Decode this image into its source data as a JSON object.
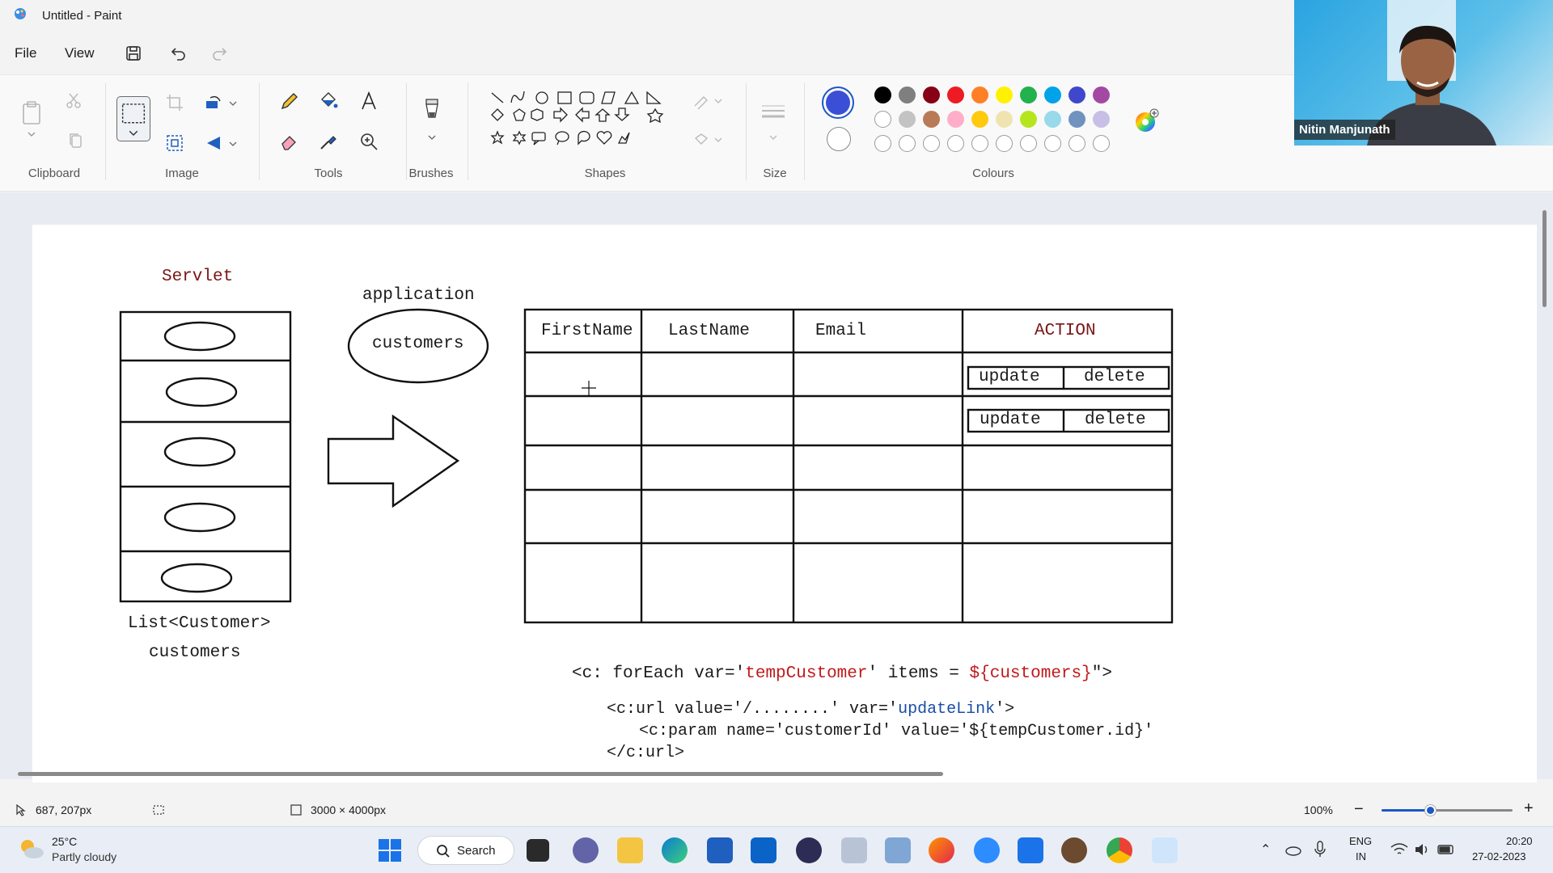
{
  "window": {
    "title": "Untitled - Paint"
  },
  "menu": {
    "file": "File",
    "view": "View"
  },
  "ribbon": {
    "groups": {
      "clipboard": "Clipboard",
      "image": "Image",
      "tools": "Tools",
      "brushes": "Brushes",
      "shapes": "Shapes",
      "size": "Size",
      "colours": "Colours"
    },
    "colours": {
      "primary": "#3b4fd6",
      "secondary": "#ffffff",
      "row1": [
        "#000000",
        "#7f7f7f",
        "#880015",
        "#ed1c24",
        "#ff7f27",
        "#fff200",
        "#22b14c",
        "#00a2e8",
        "#3f48cc",
        "#a349a4"
      ],
      "row2": [
        "#ffffff",
        "#c3c3c3",
        "#b97a57",
        "#ffaec9",
        "#ffc90e",
        "#efe4b0",
        "#b5e61d",
        "#99d9ea",
        "#7092be",
        "#c8bfe7"
      ],
      "row3_empty_count": 10
    }
  },
  "webcam": {
    "name": "Nitin Manjunath"
  },
  "canvas": {
    "servlet_label": "Servlet",
    "list_label": "List<Customer>",
    "list_var": "customers",
    "application_label": "application",
    "application_ellipse": "customers",
    "table_headers": [
      "FirstName",
      "LastName",
      "Email",
      "ACTION"
    ],
    "action_buttons": [
      "update",
      "delete"
    ],
    "code": {
      "line1_a": "<c: forEach  var='",
      "line1_b": "tempCustomer",
      "line1_c": "'  items = ",
      "line1_d": "${customers}",
      "line1_e": "\">",
      "line2_a": "<c:url value='/........' var='",
      "line2_b": "updateLink",
      "line2_c": "'>",
      "line3": "<c:param name='customerId' value='${tempCustomer.id}'",
      "line4": "</c:url>"
    }
  },
  "status": {
    "cursor_pos": "687, 207px",
    "canvas_size": "3000 × 4000px",
    "zoom": "100%"
  },
  "taskbar": {
    "weather_temp": "25°C",
    "weather_desc": "Partly cloudy",
    "search": "Search",
    "lang1": "ENG",
    "lang2": "IN",
    "time": "20:20",
    "date": "27-02-2023"
  }
}
